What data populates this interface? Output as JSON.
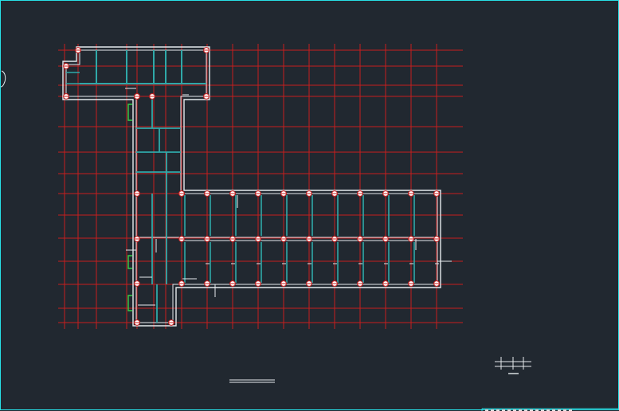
{
  "canvas": {
    "background": "#212830"
  },
  "colors": {
    "frame": "#27e0e6",
    "grid": "#c81e1e",
    "wall": "#e6eaee",
    "inner": "#2fa9a9",
    "column": "#ffffff",
    "marker": "#34d14a",
    "title": "#e6e6e6"
  },
  "plan": {
    "grid_x": [
      80,
      97,
      120,
      158,
      171,
      192,
      207,
      227,
      259,
      291,
      323,
      355,
      387,
      419,
      451,
      483,
      515,
      547
    ],
    "grid_y": [
      62,
      82,
      106,
      120,
      158,
      190,
      217,
      242,
      269,
      298,
      327,
      356,
      386,
      404
    ],
    "wing_columns_x": [
      227,
      259,
      291,
      323,
      355,
      387,
      419,
      451,
      483,
      515,
      547
    ],
    "wing_rows_y": [
      242,
      299,
      355
    ],
    "spine_columns_y": [
      120,
      242,
      299,
      355,
      404
    ],
    "top_bay_x": [
      97,
      120,
      158,
      192,
      207,
      227,
      259
    ]
  }
}
